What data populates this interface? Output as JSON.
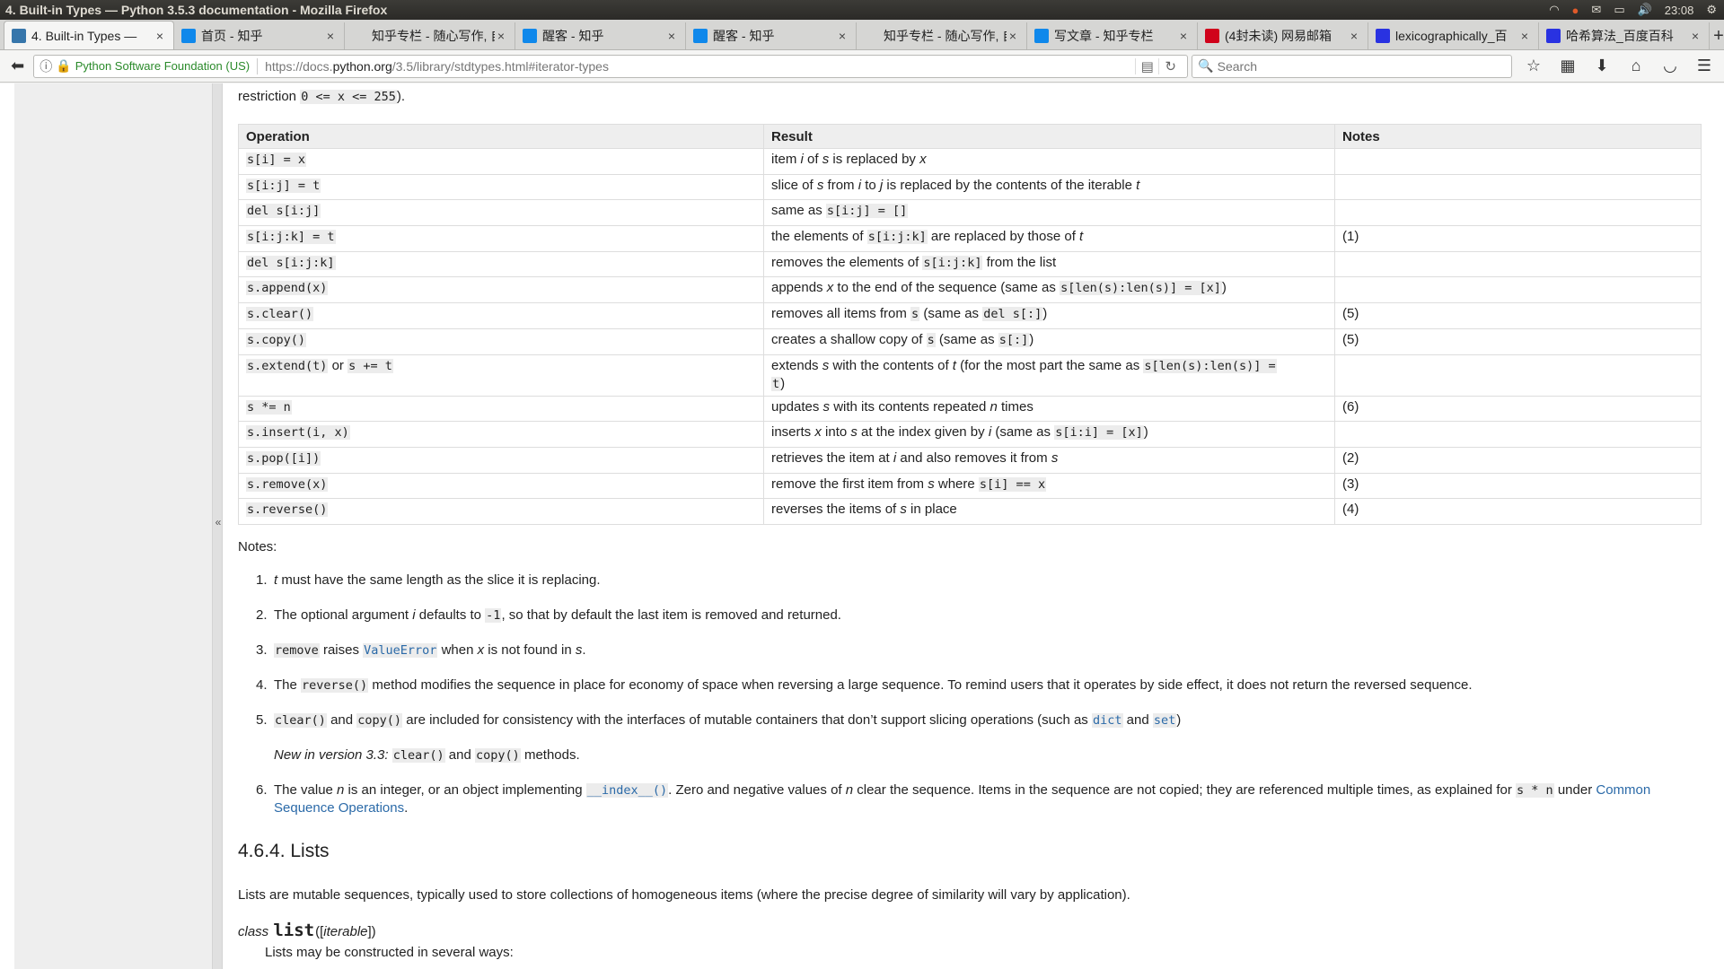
{
  "window": {
    "title": "4. Built-in Types — Python 3.5.3 documentation - Mozilla Firefox",
    "clock": "23:08"
  },
  "tabs": [
    {
      "label": "4. Built-in Types —",
      "active": true,
      "fav": "python-icon",
      "fav_color": "#3776ab"
    },
    {
      "label": "首页 - 知乎",
      "fav": "zhihu-icon",
      "fav_color": "#0f88eb"
    },
    {
      "label": "知乎专栏 - 随心写作, 自",
      "fav": "blank-icon",
      "fav_color": "#d6d6d4"
    },
    {
      "label": "醒客 - 知乎",
      "fav": "zhihu-icon",
      "fav_color": "#0f88eb"
    },
    {
      "label": "醒客 - 知乎",
      "fav": "zhihu-icon",
      "fav_color": "#0f88eb"
    },
    {
      "label": "知乎专栏 - 随心写作, 自",
      "fav": "blank-icon",
      "fav_color": "#d6d6d4"
    },
    {
      "label": "写文章 - 知乎专栏",
      "fav": "zhihu-icon",
      "fav_color": "#0f88eb"
    },
    {
      "label": "(4封未读) 网易邮箱",
      "fav": "netease-icon",
      "fav_color": "#d0021b"
    },
    {
      "label": "lexicographically_百",
      "fav": "baidu-icon",
      "fav_color": "#2932e1"
    },
    {
      "label": "哈希算法_百度百科",
      "fav": "baidu-icon",
      "fav_color": "#2932e1"
    }
  ],
  "nav": {
    "org": "Python Software Foundation (US)",
    "url_prefix": "https://docs.",
    "url_host": "python.org",
    "url_path": "/3.5/library/stdtypes.html#iterator-types",
    "search_placeholder": "Search"
  },
  "doc": {
    "restriction_pre": "restriction ",
    "restriction_code": "0 <= x <= 255",
    "restriction_post": ").",
    "headers": {
      "op": "Operation",
      "res": "Result",
      "notes": "Notes"
    },
    "rows": [
      {
        "op": "s[i] = x",
        "res_html": "item <i>i</i> of <i>s</i> is replaced by <i>x</i>",
        "note": ""
      },
      {
        "op": "s[i:j] = t",
        "res_html": "slice of <i>s</i> from <i>i</i> to <i>j</i> is replaced by the contents of the iterable <i>t</i>",
        "note": ""
      },
      {
        "op": "del s[i:j]",
        "res_html": "same as <code>s[i:j] = []</code>",
        "note": ""
      },
      {
        "op": "s[i:j:k] = t",
        "res_html": "the elements of <code>s[i:j:k]</code> are replaced by those of <i>t</i>",
        "note": "(1)"
      },
      {
        "op": "del s[i:j:k]",
        "res_html": "removes the elements of <code>s[i:j:k]</code> from the list",
        "note": ""
      },
      {
        "op": "s.append(x)",
        "res_html": "appends <i>x</i> to the end of the sequence (same as <code>s[len(s):len(s)] = [x]</code>)",
        "note": ""
      },
      {
        "op": "s.clear()",
        "res_html": "removes all items from <code>s</code> (same as <code>del s[:]</code>)",
        "note": "(5)"
      },
      {
        "op": "s.copy()",
        "res_html": "creates a shallow copy of <code>s</code> (same as <code>s[:]</code>)",
        "note": "(5)"
      },
      {
        "op_html": "<code>s.extend(t)</code> or <code>s += t</code>",
        "res_html": "extends <i>s</i> with the contents of <i>t</i> (for the most part the same as <code>s[len(s):len(s)] =</code><br><code>t</code>)",
        "note": "",
        "tall": true
      },
      {
        "op": "s *= n",
        "res_html": "updates <i>s</i> with its contents repeated <i>n</i> times",
        "note": "(6)"
      },
      {
        "op": "s.insert(i, x)",
        "res_html": "inserts <i>x</i> into <i>s</i> at the index given by <i>i</i> (same as <code>s[i:i] = [x]</code>)",
        "note": ""
      },
      {
        "op": "s.pop([i])",
        "res_html": "retrieves the item at <i>i</i> and also removes it from <i>s</i>",
        "note": "(2)"
      },
      {
        "op": "s.remove(x)",
        "res_html": "remove the first item from <i>s</i> where <code>s[i] == x</code>",
        "note": "(3)"
      },
      {
        "op": "s.reverse()",
        "res_html": "reverses the items of <i>s</i> in place",
        "note": "(4)"
      }
    ],
    "notes_heading": "Notes:",
    "notes": [
      {
        "num": "1.",
        "html": "<i>t</i> must have the same length as the slice it is replacing."
      },
      {
        "num": "2.",
        "html": "The optional argument <i>i</i> defaults to <code>-1</code>, so that by default the last item is removed and returned."
      },
      {
        "num": "3.",
        "html": "<code>remove</code> raises <code class=\"link\">ValueError</code> when <i>x</i> is not found in <i>s</i>."
      },
      {
        "num": "4.",
        "html": "The <code>reverse()</code> method modifies the sequence in place for economy of space when reversing a large sequence. To remind users that it operates by side effect, it does not return the reversed sequence."
      },
      {
        "num": "5.",
        "html": "<code>clear()</code> and <code>copy()</code> are included for consistency with the interfaces of mutable containers that don’t support slicing operations (such as <code class=\"link\">dict</code> and <code class=\"link\">set</code>)<p class=\"sub\"><i>New in version 3.3:</i> <code>clear()</code> and <code>copy()</code> methods.</p>"
      },
      {
        "num": "6.",
        "html": "The value <i>n</i> is an integer, or an object implementing <code class=\"link\">__index__()</code>. Zero and negative values of <i>n</i> clear the sequence. Items in the sequence are not copied; they are referenced multiple times, as explained for <code>s * n</code> under <span class=\"link\">Common Sequence Operations</span>."
      }
    ],
    "section_title": "4.6.4. Lists",
    "lists_para": "Lists are mutable sequences, typically used to store collections of homogeneous items (where the precise degree of similarity will vary by application).",
    "class_kw": "class",
    "class_name": "list",
    "class_args_pre": "([",
    "class_arg": "iterable",
    "class_args_post": "])",
    "constructed": "Lists may be constructed in several ways:"
  }
}
